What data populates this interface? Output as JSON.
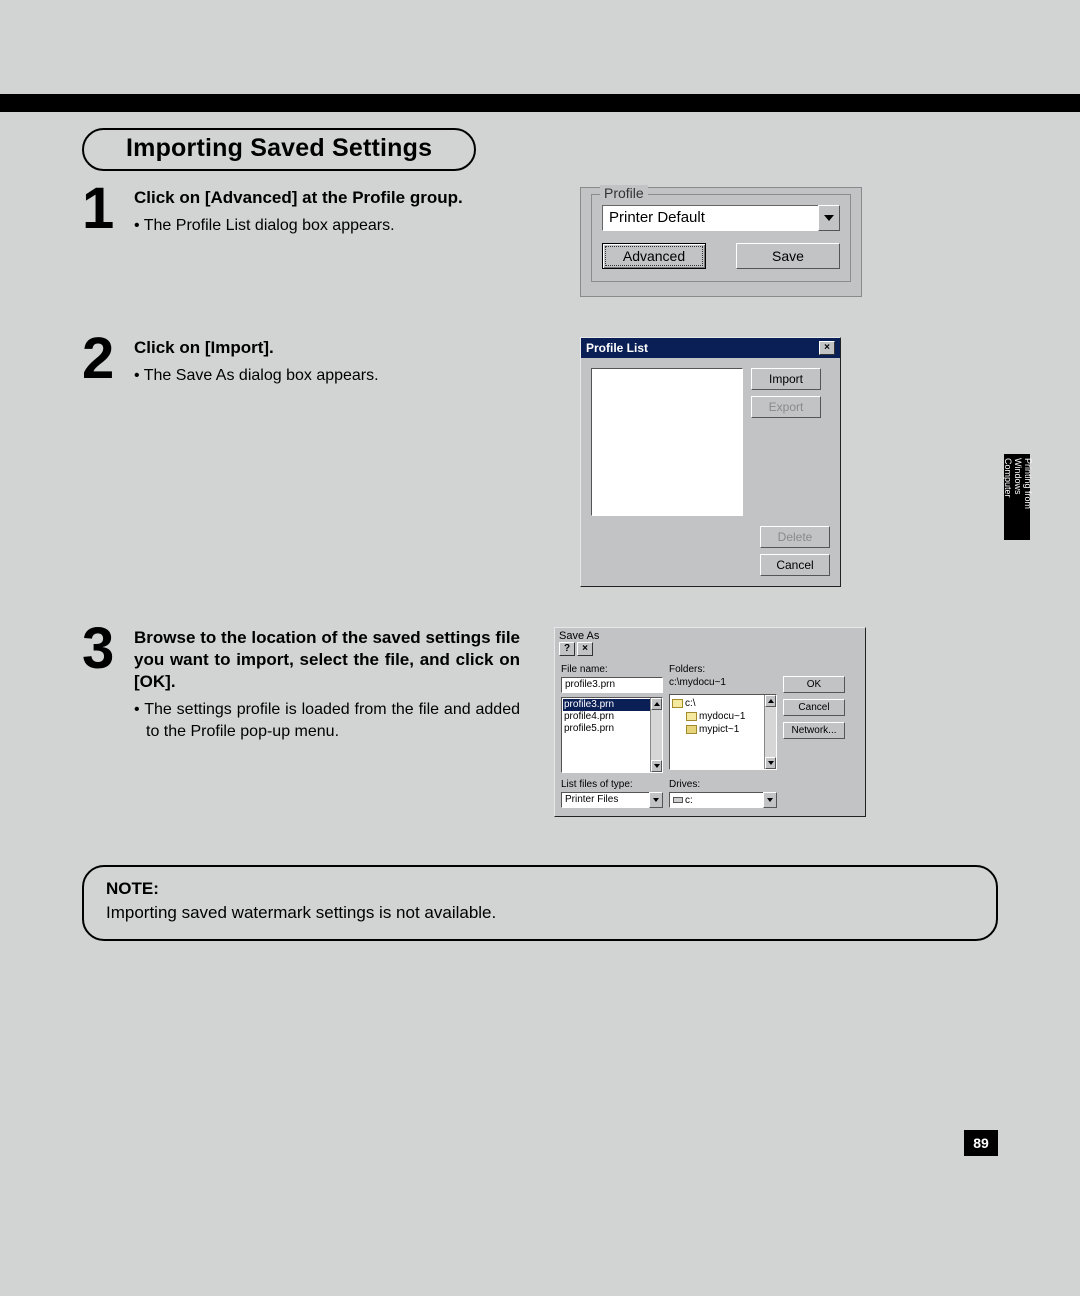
{
  "page_number": "89",
  "side_tab": "Printing from Windows Computer",
  "section_title": "Importing Saved Settings",
  "steps": {
    "s1": {
      "num": "1",
      "heading": "Click on [Advanced] at the Profile group.",
      "bullet": "• The Profile List dialog box appears."
    },
    "s2": {
      "num": "2",
      "heading": "Click on [Import].",
      "bullet": "• The Save As dialog box appears."
    },
    "s3": {
      "num": "3",
      "heading": "Browse to the location of the saved settings file you want to import, select the file, and click on [OK].",
      "bullet": "• The settings profile is loaded from the file and added to the Profile pop-up menu."
    }
  },
  "note": {
    "label": "NOTE:",
    "text": "Importing saved watermark settings is not available."
  },
  "fig1": {
    "legend": "Profile",
    "combo_value": "Printer Default",
    "btn_advanced": "Advanced",
    "btn_save": "Save"
  },
  "fig2": {
    "title": "Profile List",
    "btn_import": "Import",
    "btn_export": "Export",
    "btn_delete": "Delete",
    "btn_cancel": "Cancel",
    "close": "×"
  },
  "fig3": {
    "title": "Save As",
    "help": "?",
    "close": "×",
    "lbl_filename": "File name:",
    "filename_value": "profile3.prn",
    "lbl_folders": "Folders:",
    "folder_path": "c:\\mydocu~1",
    "files": {
      "f0": "profile3.prn",
      "f1": "profile4.prn",
      "f2": "profile5.prn"
    },
    "tree": {
      "t0": "c:\\",
      "t1": "mydocu~1",
      "t2": "mypict~1"
    },
    "lbl_listtype": "List files of type:",
    "listtype_value": "Printer Files",
    "lbl_drives": "Drives:",
    "drives_value": "c:",
    "btn_ok": "OK",
    "btn_cancel": "Cancel",
    "btn_network": "Network..."
  }
}
